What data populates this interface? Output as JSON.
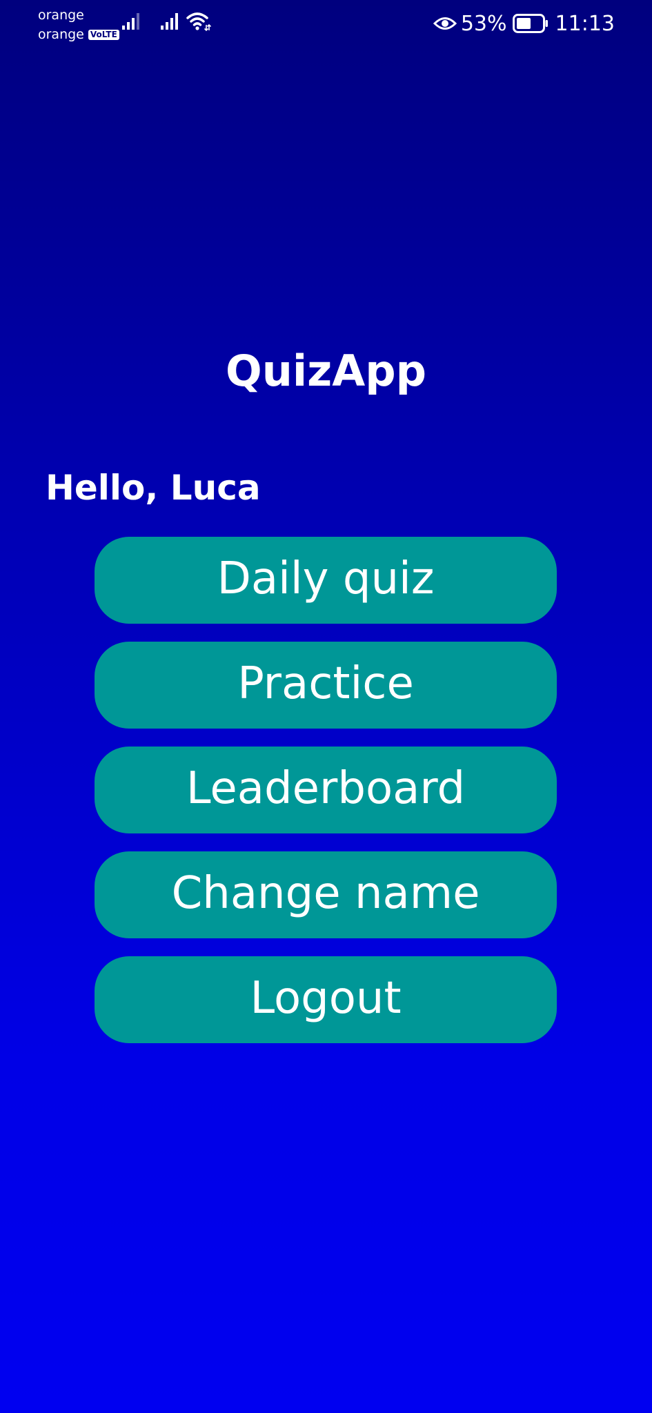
{
  "status_bar": {
    "carrier_1": "orange",
    "carrier_2": "orange",
    "volte_badge": "VoLTE",
    "battery_percent": "53%",
    "time": "11:13",
    "icons": [
      "signal-icon",
      "signal-icon",
      "wifi-icon",
      "eye-icon",
      "battery-icon"
    ]
  },
  "app": {
    "title": "QuizApp",
    "greeting": "Hello, Luca"
  },
  "menu": {
    "daily_quiz": "Daily quiz",
    "practice": "Practice",
    "leaderboard": "Leaderboard",
    "change_name": "Change name",
    "logout": "Logout"
  },
  "colors": {
    "background_top": "#00007e",
    "background_bottom": "#0000f0",
    "button": "#009797",
    "text": "#ffffff"
  }
}
